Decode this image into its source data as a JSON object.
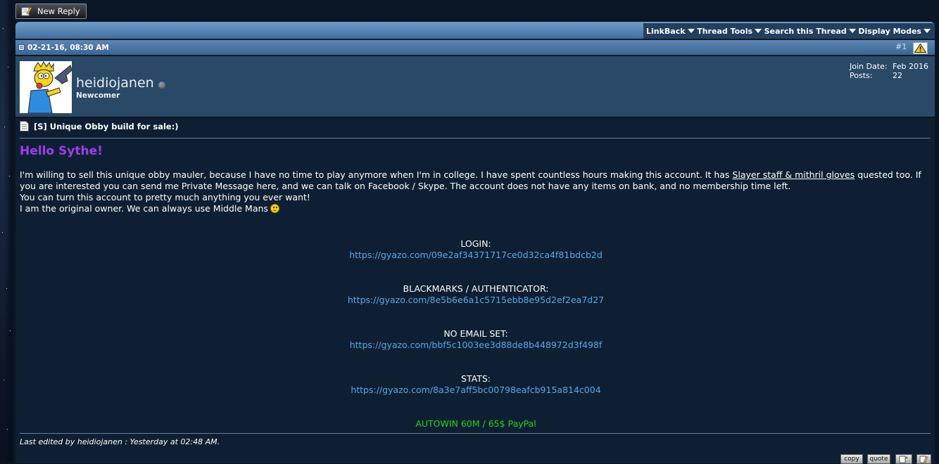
{
  "toolbar": {
    "new_reply_label": "New Reply"
  },
  "thread_tools": [
    {
      "label": "LinkBack"
    },
    {
      "label": "Thread Tools"
    },
    {
      "label": "Search this Thread"
    },
    {
      "label": "Display Modes"
    }
  ],
  "post": {
    "date": "02-21-16, 08:30 AM",
    "number": "#1",
    "user": {
      "name": "heidiojanen",
      "rank": "Newcomer",
      "join_date_label": "Join Date:",
      "join_date": "Feb 2016",
      "posts_label": "Posts:",
      "posts": "22"
    },
    "title": "[S] Unique Obby build for sale:)",
    "greeting": "Hello Sythe!",
    "body": {
      "p1_before": "I'm willing to sell this unique obby mauler, because I have no time to play anymore when I'm in college. I have spent countless hours making this account. It has ",
      "p1_underlined": "Slayer staff & mithril gloves",
      "p1_after": " quested too. If you are interested you can send me Private Message here, and we can talk on Facebook / Skype. The account does not have any items on bank, and no membership time left.",
      "p2": "You can turn this account to pretty much anything you ever want!",
      "p3": "I am the original owner. We can always use Middle Mans"
    },
    "sections": [
      {
        "heading": "LOGIN:",
        "link": "https://gyazo.com/09e2af34371717ce0d32ca4f81bdcb2d"
      },
      {
        "heading": "BLACKMARKS / AUTHENTICATOR:",
        "link": "https://gyazo.com/8e5b6e6a1c5715ebb8e95d2ef2ea7d27"
      },
      {
        "heading": "NO EMAIL SET:",
        "link": "https://gyazo.com/bbf5c1003ee3d88de8b448972d3f498f"
      },
      {
        "heading": "STATS:",
        "link": "https://gyazo.com/8a3e7aff5bc00798eafcb915a814c004"
      }
    ],
    "price": "AUTOWIN 60M / 65$ PayPal",
    "edited": "Last edited by heidiojanen : Yesterday at 02:48 AM."
  },
  "actions": {
    "copy_label": "copy",
    "quote_label": "quote"
  },
  "colors": {
    "greeting": "#a03cf0",
    "link": "#5aa8e8",
    "price": "#22d31c",
    "header_blue": "#4a76a6",
    "content_bg": "#0f1f33"
  }
}
